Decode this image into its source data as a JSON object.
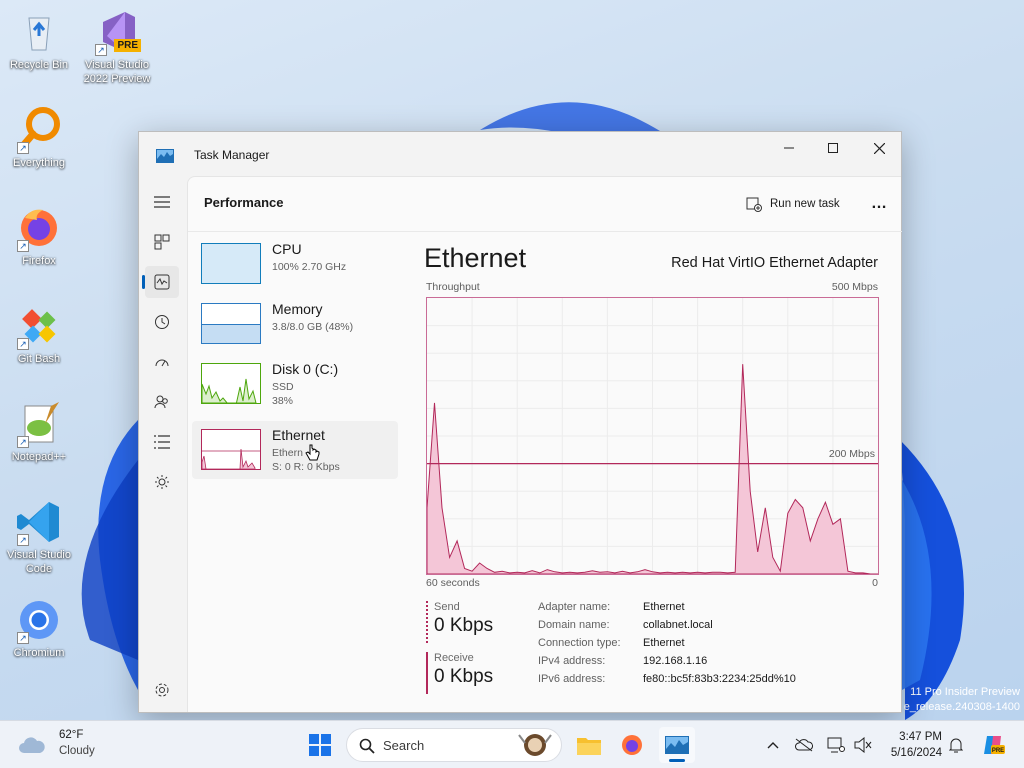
{
  "desktop": {
    "icons": [
      {
        "label": "Recycle Bin"
      },
      {
        "label": "Visual Studio 2022 Preview",
        "badge": "PRE"
      },
      {
        "label": "Everything"
      },
      {
        "label": "Firefox"
      },
      {
        "label": "Git Bash"
      },
      {
        "label": "Notepad++"
      },
      {
        "label": "Visual Studio Code"
      },
      {
        "label": "Chromium"
      }
    ],
    "watermark_line1": "11 Pro Insider Preview",
    "watermark_line2": "e_release.240308-1400"
  },
  "window": {
    "title": "Task Manager",
    "section_title": "Performance",
    "run_new_task": "Run new task",
    "more": "…"
  },
  "devices": [
    {
      "name": "CPU",
      "sub1": "100%  2.70 GHz",
      "sub2": ""
    },
    {
      "name": "Memory",
      "sub1": "3.8/8.0 GB (48%)",
      "sub2": ""
    },
    {
      "name": "Disk 0 (C:)",
      "sub1": "SSD",
      "sub2": "38%"
    },
    {
      "name": "Ethernet",
      "sub1": "Ethern",
      "sub2": "S: 0  R: 0 Kbps"
    }
  ],
  "detail": {
    "title": "Ethernet",
    "adapter": "Red Hat VirtIO Ethernet Adapter",
    "throughput_label": "Throughput",
    "max_label": "500 Mbps",
    "mid_label": "200 Mbps",
    "time_label": "60 seconds",
    "zero_label": "0",
    "send_label": "Send",
    "send_value": "0 Kbps",
    "receive_label": "Receive",
    "receive_value": "0 Kbps",
    "properties": [
      {
        "key": "Adapter name:",
        "value": "Ethernet"
      },
      {
        "key": "Domain name:",
        "value": "collabnet.local"
      },
      {
        "key": "Connection type:",
        "value": "Ethernet"
      },
      {
        "key": "IPv4 address:",
        "value": "192.168.1.16"
      },
      {
        "key": "IPv6 address:",
        "value": "fe80::bc5f:83b3:2234:25dd%10"
      }
    ]
  },
  "chart_data": {
    "type": "area",
    "title": "",
    "xlabel": "",
    "ylabel": "Throughput",
    "x_unit": "seconds ago",
    "xlim": [
      60,
      0
    ],
    "y_scale_mbps": 500,
    "reference_line_mbps": 200,
    "series": [
      {
        "name": "Receive",
        "x": [
          60,
          59,
          58,
          57,
          56,
          55,
          54,
          53,
          52,
          51,
          50,
          49,
          48,
          47,
          46,
          45,
          44,
          43,
          42,
          41,
          40,
          39,
          38,
          37,
          36,
          35,
          34,
          33,
          32,
          31,
          30,
          29,
          28,
          27,
          26,
          25,
          24,
          23,
          22,
          21,
          20,
          19,
          18,
          17,
          16,
          15,
          14,
          13,
          12,
          11,
          10,
          9,
          8,
          7,
          6,
          5,
          4,
          3,
          2,
          1,
          0
        ],
        "values": [
          120,
          310,
          120,
          30,
          60,
          10,
          5,
          20,
          10,
          3,
          5,
          2,
          3,
          2,
          6,
          2,
          8,
          4,
          2,
          3,
          2,
          3,
          6,
          3,
          4,
          2,
          5,
          2,
          4,
          8,
          4,
          2,
          3,
          2,
          3,
          2,
          3,
          2,
          3,
          3,
          2,
          3,
          380,
          150,
          40,
          120,
          30,
          5,
          110,
          135,
          120,
          60,
          100,
          130,
          90,
          100,
          5,
          2,
          2,
          0,
          0
        ]
      }
    ]
  },
  "taskbar": {
    "weather_temp": "62°F",
    "weather_cond": "Cloudy",
    "search_placeholder": "Search",
    "time": "3:47 PM",
    "date": "5/16/2024"
  },
  "colors": {
    "accent": "#005fb8",
    "network": "#b2285a",
    "network_fill": "#f4c6d7",
    "cpu": "#117dbb",
    "disk": "#4da60c"
  }
}
